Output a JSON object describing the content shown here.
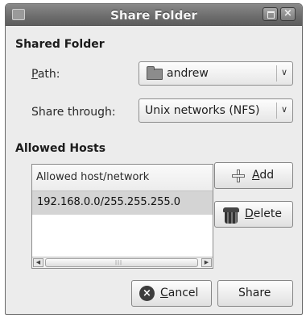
{
  "window": {
    "title": "Share Folder"
  },
  "shared_folder": {
    "heading": "Shared Folder",
    "path_label": "Path:",
    "path_value": "andrew",
    "share_through_label": "Share through:",
    "share_through_value": "Unix networks (NFS)"
  },
  "allowed_hosts": {
    "heading": "Allowed Hosts",
    "column_header": "Allowed host/network",
    "rows": [
      "192.168.0.0/255.255.255.0"
    ],
    "add_label": "Add",
    "delete_label": "Delete"
  },
  "footer": {
    "cancel_label": "Cancel",
    "share_label": "Share"
  },
  "icons": [
    "folder-icon",
    "add-icon",
    "trash-icon",
    "cancel-icon",
    "close-icon",
    "maximize-icon",
    "chevron-down-icon"
  ]
}
